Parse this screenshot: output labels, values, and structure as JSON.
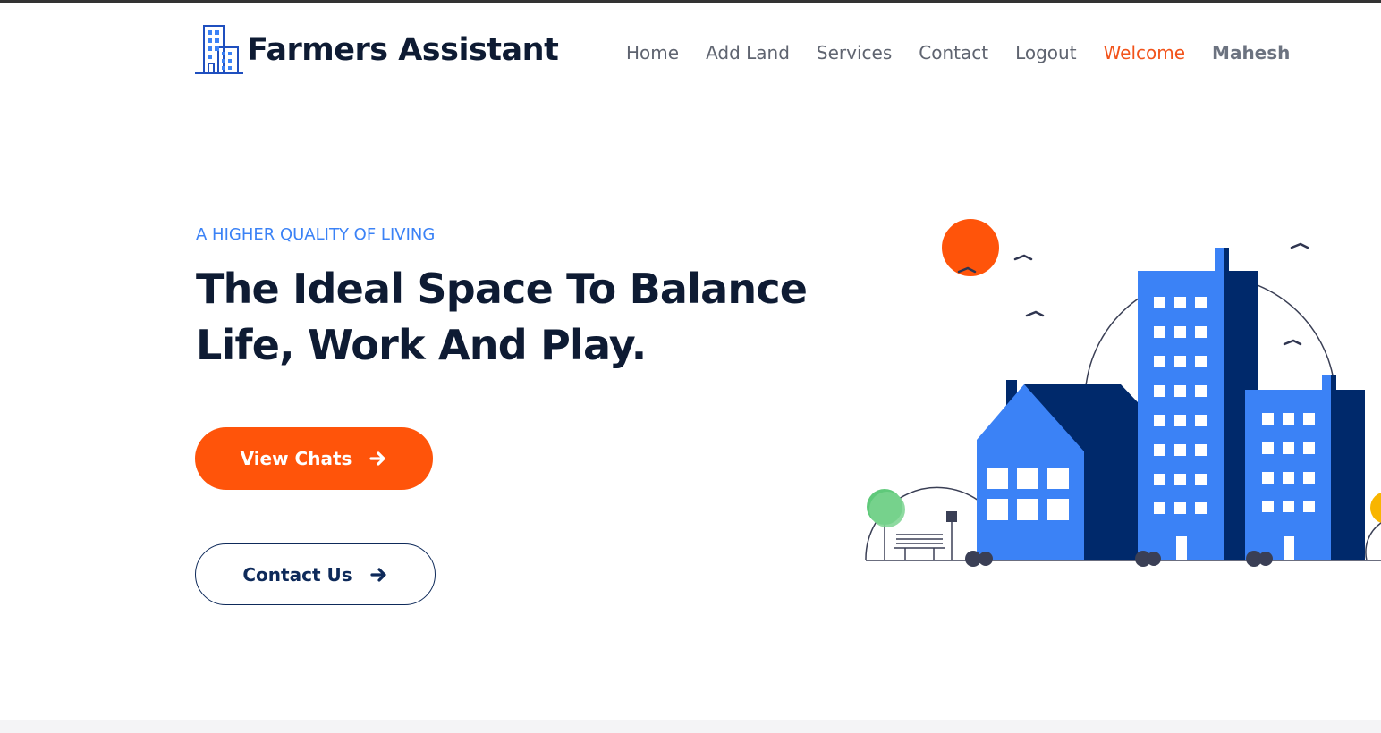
{
  "brand": {
    "name": "Farmers Assistant",
    "icon": "building-logo-icon"
  },
  "nav": {
    "items": [
      {
        "label": "Home"
      },
      {
        "label": "Add Land"
      },
      {
        "label": "Services"
      },
      {
        "label": "Contact"
      },
      {
        "label": "Logout"
      }
    ],
    "welcome": "Welcome",
    "username": "Mahesh"
  },
  "hero": {
    "eyebrow": "A HIGHER QUALITY OF LIVING",
    "headline": "The Ideal Space To Balance Life, Work And Play.",
    "primary_button": {
      "label": "View Chats",
      "icon": "arrow-right-icon"
    },
    "secondary_button": {
      "label": "Contact Us",
      "icon": "arrow-right-icon"
    }
  },
  "illustration": {
    "icon": "city-buildings-illustration"
  },
  "colors": {
    "accent": "#ff540a",
    "brand_blue": "#3b82f6",
    "navy": "#0e1b33",
    "dark_blue": "#00296b",
    "welcome": "#f2531a"
  }
}
